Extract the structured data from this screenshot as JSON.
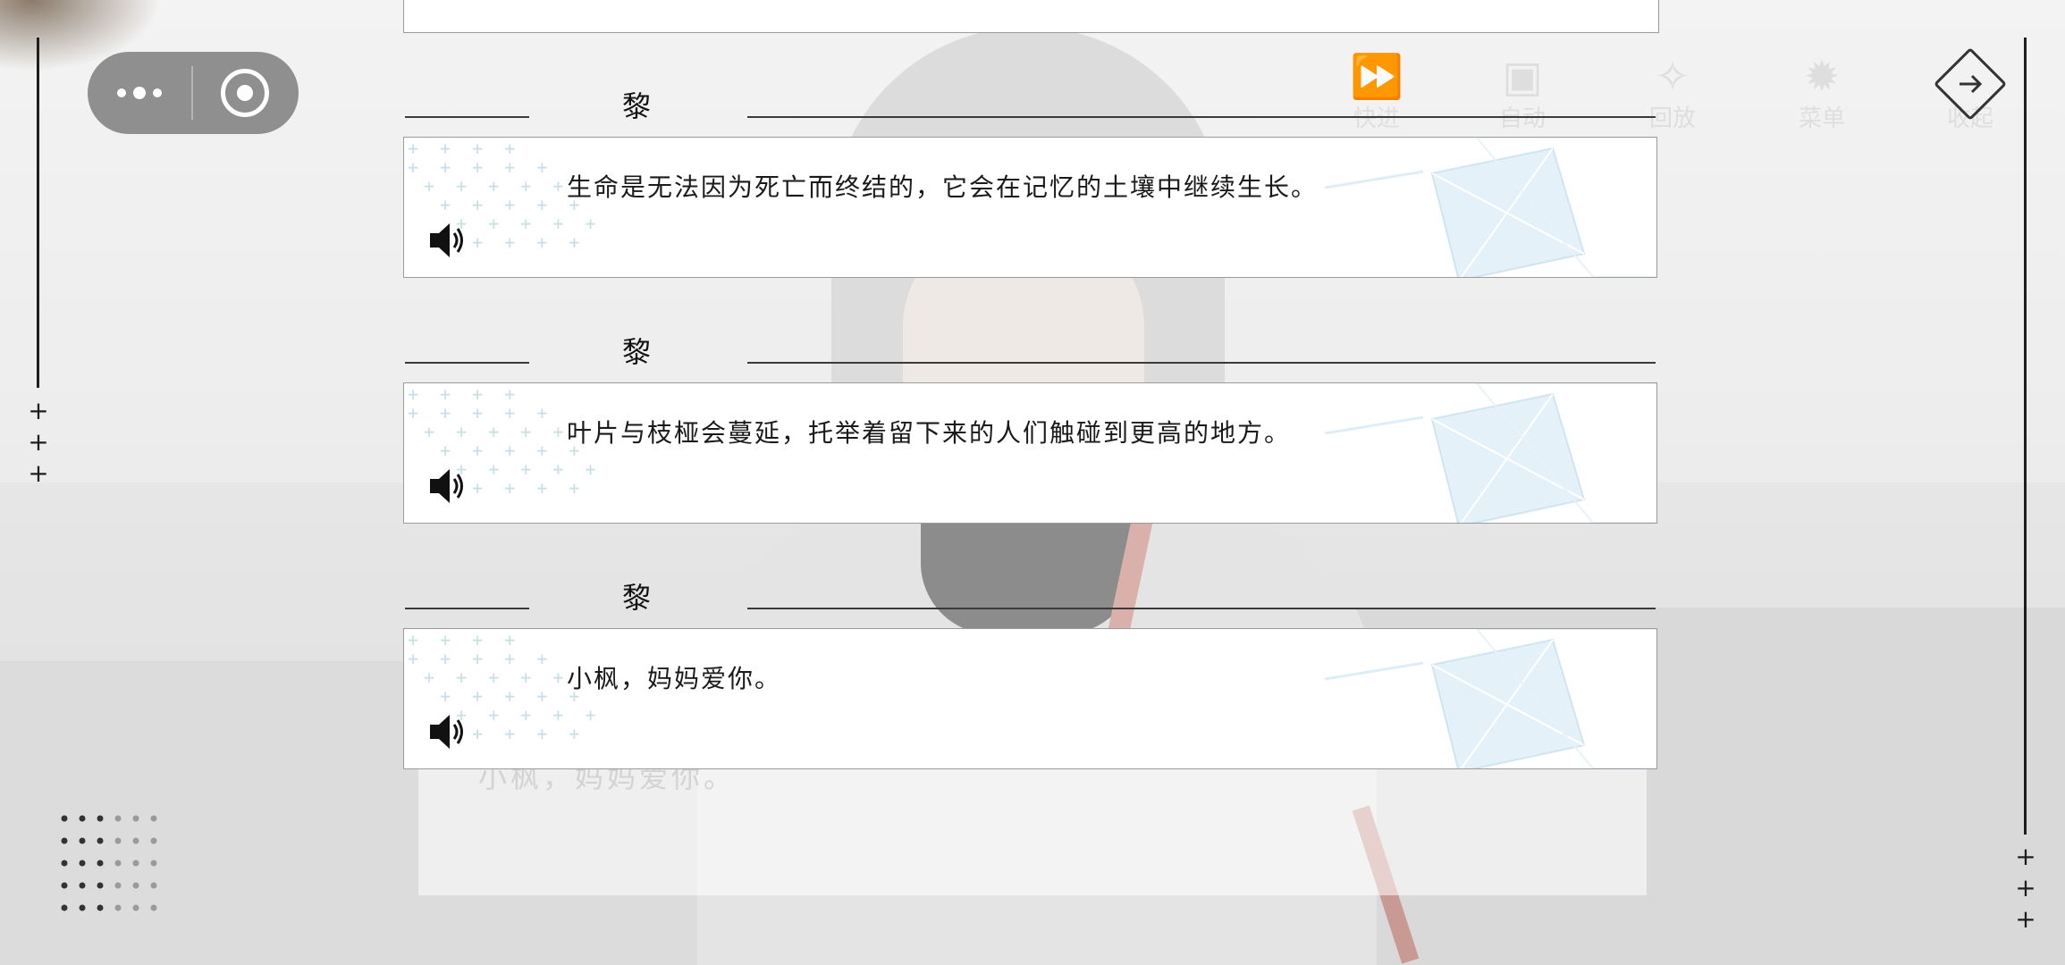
{
  "background": {
    "hud_labels": [
      "快进",
      "自动",
      "回放",
      "菜单",
      "收起"
    ],
    "dialog_text": "小枫，妈妈爱你。"
  },
  "log": {
    "entries": [
      {
        "speaker": "黎",
        "text": "生命是无法因为死亡而终结的，它会在记忆的土壤中继续生长。"
      },
      {
        "speaker": "黎",
        "text": "叶片与枝桠会蔓延，托举着留下来的人们触碰到更高的地方。"
      },
      {
        "speaker": "黎",
        "text": "小枫，妈妈爱你。"
      }
    ]
  },
  "icons": {
    "more": "more-dots-icon",
    "close": "target-circle-icon",
    "back": "arrow-right-diamond-icon",
    "voice": "speaker-icon"
  },
  "colors": {
    "capsule": "#8f8f8f",
    "card": "#ffffff",
    "rail": "#1e1e1e",
    "accent_blue": "#d6e9f3"
  }
}
